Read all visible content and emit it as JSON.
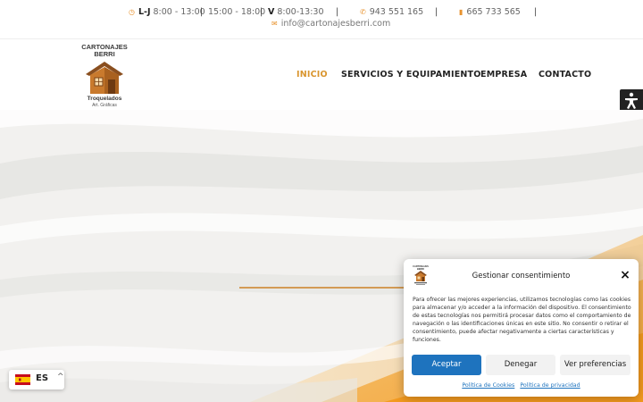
{
  "topbar": {
    "hours_lj_label": "L-J",
    "hours_lj_morning": "8:00 - 13:00",
    "hours_lj_afternoon": "15:00 - 18:00",
    "hours_v_label": "V",
    "hours_v": "8:00-13:30",
    "separator": "|",
    "phone": "943 551 165",
    "mobile": "665 733 565",
    "email": "info@cartonajesberri.com"
  },
  "logo": {
    "title_line1": "CARTONAJES",
    "title_line2": "BERRI",
    "subtitle": "Troquelados",
    "tagline": "Art. Gráficas"
  },
  "nav": {
    "items": [
      {
        "label": "INICIO",
        "active": true
      },
      {
        "label": "SERVICIOS Y EQUIPAMIENTO",
        "active": false
      },
      {
        "label": "EMPRESA",
        "active": false
      },
      {
        "label": "CONTACTO",
        "active": false
      }
    ]
  },
  "accessibility": {
    "icon": "accessibility-icon"
  },
  "language": {
    "code": "ES",
    "flag": "spain-flag-icon",
    "chevron": "^"
  },
  "consent": {
    "title": "Gestionar consentimiento",
    "close": "×",
    "body": "Para ofrecer las mejores experiencias, utilizamos tecnologías como las cookies para almacenar y/o acceder a la información del dispositivo. El consentimiento de estas tecnologías nos permitirá procesar datos como el comportamiento de navegación o las identificaciones únicas en este sitio. No consentir o retirar el consentimiento, puede afectar negativamente a ciertas características y funciones.",
    "accept_label": "Aceptar",
    "deny_label": "Denegar",
    "prefs_label": "Ver preferencias",
    "cookie_policy": "Política de Cookies",
    "privacy_policy": "Política de privacidad"
  },
  "colors": {
    "accent": "#d9952e",
    "primary_button": "#1e73be",
    "hero_orange": "#f0a030"
  }
}
